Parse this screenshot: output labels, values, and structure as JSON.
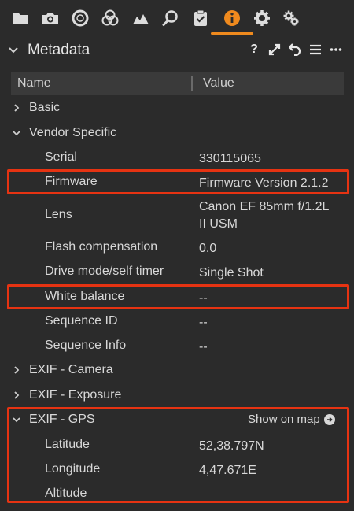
{
  "toolbar": {
    "tabs": [
      {
        "icon": "folder-icon"
      },
      {
        "icon": "camera-icon"
      },
      {
        "icon": "lens-icon"
      },
      {
        "icon": "color-circles-icon"
      },
      {
        "icon": "exposure-icon"
      },
      {
        "icon": "search-icon"
      },
      {
        "icon": "clipboard-check-icon"
      },
      {
        "icon": "info-icon",
        "active": true
      },
      {
        "icon": "gear-icon"
      },
      {
        "icon": "gears-icon"
      }
    ],
    "accent": "#ef8a1e"
  },
  "panel": {
    "title": "Metadata",
    "help": "?",
    "tools": [
      "expand-icon",
      "reset-icon",
      "menu-icon",
      "more-icon"
    ]
  },
  "columns": {
    "name": "Name",
    "value": "Value"
  },
  "groups": {
    "basic": "Basic",
    "vendor": "Vendor Specific",
    "exif_camera": "EXIF - Camera",
    "exif_exposure": "EXIF - Exposure",
    "exif_gps": "EXIF - GPS"
  },
  "vendor_rows": [
    {
      "name": "Serial",
      "value": "330115065"
    },
    {
      "name": "Firmware",
      "value": "Firmware Version 2.1.2"
    },
    {
      "name": "Lens",
      "value": "Canon EF 85mm f/1.2L",
      "value2": "II USM"
    },
    {
      "name": "Flash compensation",
      "value": "0.0"
    },
    {
      "name": "Drive mode/self timer",
      "value": "Single Shot"
    },
    {
      "name": "White balance",
      "value": "--"
    },
    {
      "name": "Sequence ID",
      "value": "--"
    },
    {
      "name": "Sequence Info",
      "value": "--"
    }
  ],
  "gps": {
    "show_on_map": "Show on map",
    "rows": [
      {
        "name": "Latitude",
        "value": "52,38.797N"
      },
      {
        "name": "Longitude",
        "value": "4,47.671E"
      },
      {
        "name": "Altitude",
        "value": ""
      }
    ]
  },
  "highlight_color": "#e63312"
}
